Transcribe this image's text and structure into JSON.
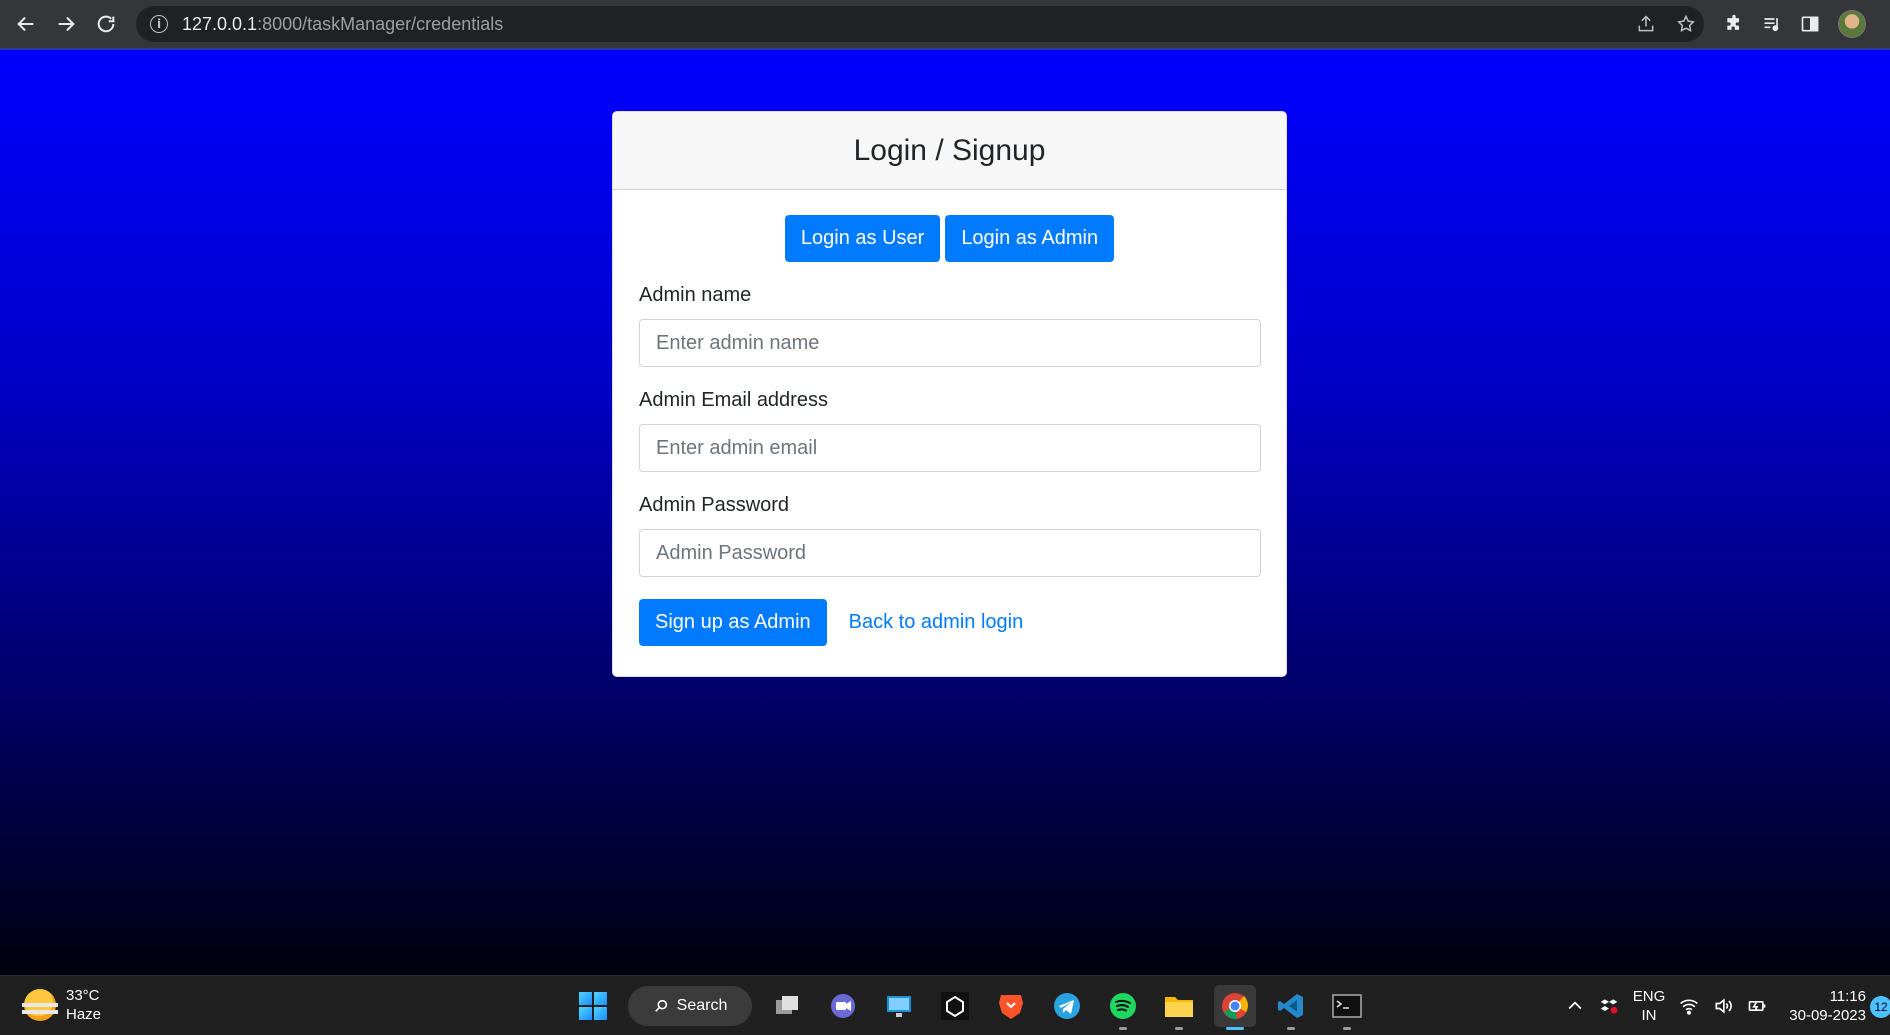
{
  "browser": {
    "url_host": "127.0.0.1",
    "url_path": ":8000/taskManager/credentials"
  },
  "card": {
    "title": "Login / Signup",
    "tabs": {
      "user_label": "Login as User",
      "admin_label": "Login as Admin"
    },
    "fields": {
      "name_label": "Admin name",
      "name_placeholder": "Enter admin name",
      "email_label": "Admin Email address",
      "email_placeholder": "Enter admin email",
      "password_label": "Admin Password",
      "password_placeholder": "Admin Password"
    },
    "submit_label": "Sign up as Admin",
    "back_link": "Back to admin login"
  },
  "taskbar": {
    "weather_temp": "33°C",
    "weather_desc": "Haze",
    "search_label": "Search",
    "lang_1": "ENG",
    "lang_2": "IN",
    "time": "11:16",
    "date": "30-09-2023",
    "notification_count": "12"
  },
  "colors": {
    "primary": "#007bff",
    "background_top": "#0000ff",
    "background_bottom": "#00000d"
  }
}
